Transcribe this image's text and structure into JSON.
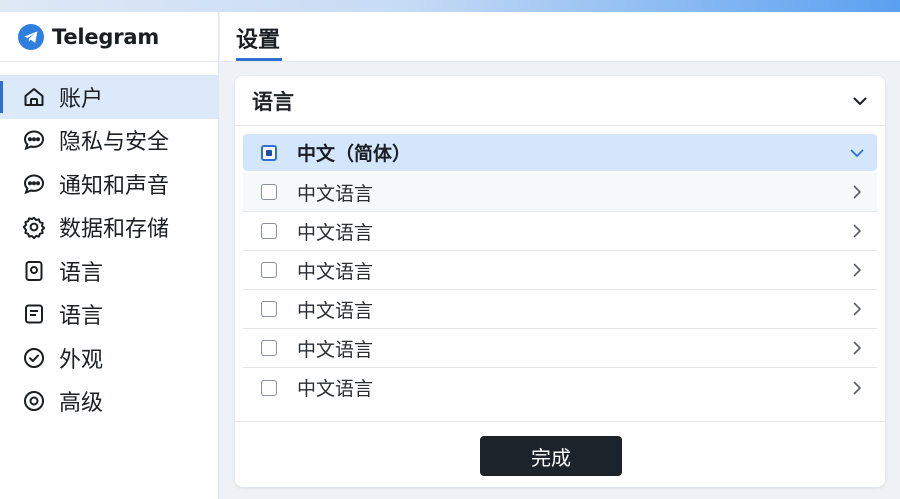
{
  "app": {
    "name": "Telegram"
  },
  "header": {
    "title": "设置"
  },
  "sidebar": {
    "items": [
      {
        "label": "账户",
        "icon": "home-icon",
        "active": true
      },
      {
        "label": "隐私与安全",
        "icon": "chat-bubble-icon"
      },
      {
        "label": "通知和声音",
        "icon": "chat-bubble-icon"
      },
      {
        "label": "数据和存储",
        "icon": "gear-icon"
      },
      {
        "label": "语言",
        "icon": "language-badge-icon"
      },
      {
        "label": "语言",
        "icon": "note-icon"
      },
      {
        "label": "外观",
        "icon": "check-circle-icon"
      },
      {
        "label": "高级",
        "icon": "target-icon"
      }
    ]
  },
  "language_panel": {
    "title": "语言",
    "items": [
      {
        "label": "中文（简体）",
        "checked": true
      },
      {
        "label": "中文语言",
        "checked": false
      },
      {
        "label": "中文语言",
        "checked": false
      },
      {
        "label": "中文语言",
        "checked": false
      },
      {
        "label": "中文语言",
        "checked": false
      },
      {
        "label": "中文语言",
        "checked": false
      },
      {
        "label": "中文语言",
        "checked": false
      }
    ],
    "done_label": "完成"
  },
  "colors": {
    "accent": "#2f6fd0",
    "selected_bg": "#d3e6fb",
    "button_bg": "#1d232b"
  }
}
